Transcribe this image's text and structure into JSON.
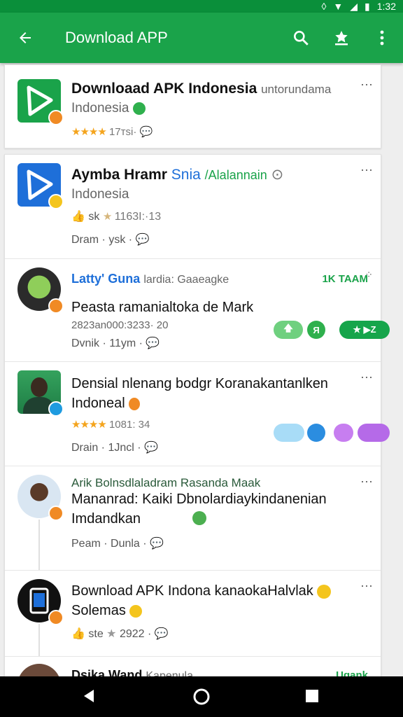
{
  "status": {
    "time": "1:32"
  },
  "toolbar": {
    "title": "Download APP"
  },
  "items": [
    {
      "title": "Downloaad APK Indonesia",
      "title_extra": "untorundama",
      "sub": "Indonesia",
      "meta": "17тsi·",
      "stars": "★★★★"
    },
    {
      "title": "Aymba Hramr",
      "title_blue": "Snia",
      "title_green": "/Alalannain",
      "sub": "Indonesia",
      "meta1": "sk",
      "meta1b": "1163I:·13",
      "meta2": "Dram · ysk ·"
    },
    {
      "name": "Latty' Guna",
      "name_extra": "lardia: Gaaeagke",
      "right_tag": "1K TAAM",
      "body": "Peasta ramanialtoka de Mark",
      "meta1": "2823an000:3233· 20",
      "meta2": "Dvnik · 11ym ·",
      "chip1": "🡅",
      "chip2": "Я",
      "chip3": "★ ▶Z"
    },
    {
      "body": "Densial nlenang bodgr Koranakantanlken",
      "body2": "Indoneal",
      "meta1": "1081: 34",
      "meta2": "Drain · 1Jncl ·",
      "stars": "★★★★"
    },
    {
      "name": "Arik Bolnsdlaladram Rasanda Maak",
      "body": "Mananrad: Kaiki Dbnolardiaykindanenian",
      "body2": "Imdandkan",
      "meta2": "Peam · Dunla ·"
    },
    {
      "title": "Bownload APK Indona kanaokaHalvlak",
      "body2": "Solemas",
      "meta1": "ste",
      "meta1b": "2922 ·"
    },
    {
      "name": "Dsika Wand",
      "name_extra": "Kapenula",
      "right_tag": "Ugank"
    }
  ],
  "colors": {
    "green": "#1aa34a",
    "dark_green": "#0a8f3a",
    "orange": "#f08a24",
    "blue": "#1e6fd9"
  }
}
